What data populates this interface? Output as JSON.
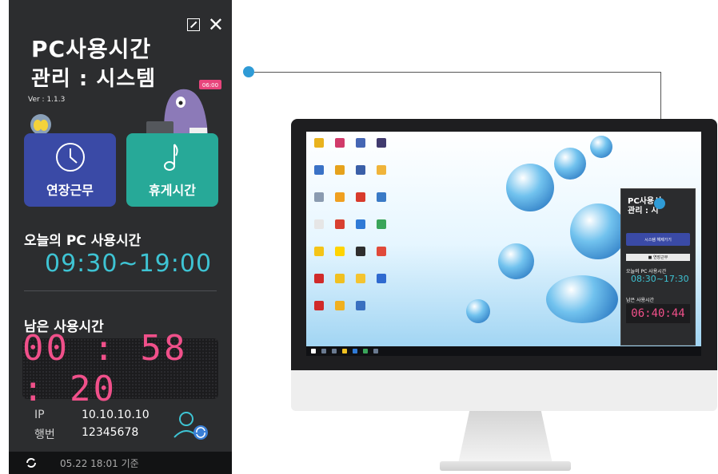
{
  "panel": {
    "title_line1": "PC사용시간",
    "title_line2": "관리 : 시스템",
    "version": "Ver : 1.1.3",
    "badge": "06:00",
    "buttons": [
      {
        "label": "연장근무",
        "icon": "clock-icon"
      },
      {
        "label": "휴게시간",
        "icon": "music-note-icon"
      }
    ],
    "today_label": "오늘의 PC 사용시간",
    "today_range": "09:30~19:00",
    "remaining_label": "남은 사용시간",
    "remaining_time": "00 : 58 : 20",
    "ip_label": "IP",
    "ip_value": "10.10.10.10",
    "number_label": "행번",
    "number_value": "12345678",
    "footer_time": "05.22 18:01 기준"
  },
  "mini_panel": {
    "title_line1": "PC사용시",
    "title_line2": "관리 : 시",
    "button_label": "시스템 해제가기",
    "small_button": "■ 연장근무",
    "today_label": "오늘의 PC 사용시간",
    "today_range": "08:30~17:30",
    "remaining_label": "남은 사용시간",
    "remaining_time": "06:40:44"
  },
  "colors": {
    "panel_bg": "#2c2d2f",
    "accent_blue": "#3a4aa6",
    "accent_teal": "#27a998",
    "time_cyan": "#3ec3d3",
    "led_pink": "#f0508a",
    "connector": "#2f9bd6"
  }
}
